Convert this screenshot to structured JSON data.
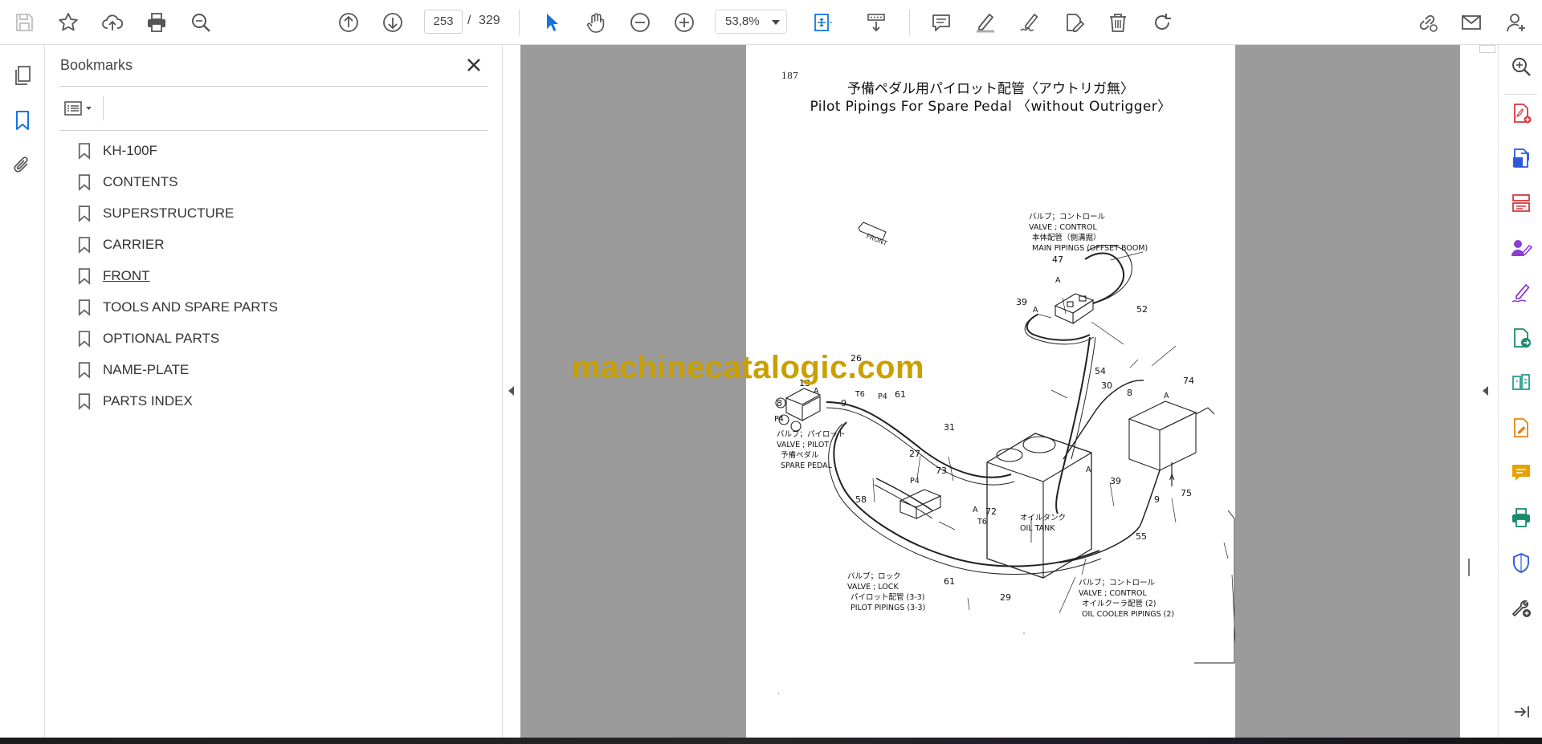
{
  "toolbar": {
    "current_page": "253",
    "page_separator": "/",
    "total_pages": "329",
    "zoom_value": "53,8%"
  },
  "bookmarks_panel": {
    "title": "Bookmarks",
    "items": [
      {
        "label": "KH-100F"
      },
      {
        "label": "CONTENTS"
      },
      {
        "label": "SUPERSTRUCTURE"
      },
      {
        "label": "CARRIER"
      },
      {
        "label": "FRONT"
      },
      {
        "label": "TOOLS AND SPARE PARTS"
      },
      {
        "label": "OPTIONAL PARTS"
      },
      {
        "label": "NAME-PLATE"
      },
      {
        "label": "PARTS INDEX"
      }
    ]
  },
  "document": {
    "page_number": "187",
    "title_jp": "予備ペダル用パイロット配管〈アウトリガ無〉",
    "title_en": "Pilot Pipings For Spare Pedal 〈without Outrigger〉",
    "labels": {
      "front": "FRONT",
      "valve_control_top_jp": "バルブ；コントロール",
      "valve_control_top_en": "VALVE ; CONTROL",
      "main_pipings_jp": "本体配管（側溝掘）",
      "main_pipings_en": "MAIN PIPINGS (OFFSET BOOM)",
      "valve_pilot_jp": "バルブ；パイロット",
      "valve_pilot_en": "VALVE ; PILOT",
      "spare_pedal_jp": "予備ペダル",
      "spare_pedal_en": "SPARE PEDAL",
      "oil_tank_jp": "オイルタンク",
      "oil_tank_en": "OIL TANK",
      "valve_lock_jp": "バルブ；ロック",
      "valve_lock_en": "VALVE ; LOCK",
      "pilot_pipings_jp": "パイロット配管 (3-3)",
      "pilot_pipings_en": "PILOT PIPINGS (3-3)",
      "valve_control_bottom_jp": "バルブ；コントロール",
      "valve_control_bottom_en": "VALVE ; CONTROL",
      "oil_cooler_jp": "オイルクーラ配管 (2)",
      "oil_cooler_en": "OIL COOLER PIPINGS (2)",
      "port_a": "A",
      "port_p4": "P4",
      "port_t6": "T6"
    },
    "callouts": [
      "47",
      "39",
      "52",
      "26",
      "13",
      "8",
      "9",
      "61",
      "31",
      "54",
      "30",
      "8",
      "74",
      "27",
      "73",
      "39",
      "75",
      "9",
      "58",
      "72",
      "55",
      "61",
      "29"
    ]
  },
  "watermark": "machinecatalogic.com",
  "icons": {
    "toolbar_left": [
      "save-icon",
      "bookmark-star-icon",
      "upload-cloud-icon",
      "print-icon",
      "zoom-search-icon"
    ],
    "toolbar_nav": [
      "prev-page-icon",
      "next-page-icon"
    ],
    "toolbar_tools": [
      "select-arrow-icon",
      "hand-icon",
      "zoom-out-icon",
      "zoom-in-icon",
      "fit-page-icon",
      "scroll-mode-icon",
      "comment-icon",
      "highlight-pen-icon",
      "sign-icon",
      "fill-sign-icon",
      "delete-icon",
      "rotate-icon"
    ],
    "toolbar_right": [
      "share-link-icon",
      "email-icon",
      "account-icon"
    ],
    "accent": "#1473e6"
  }
}
